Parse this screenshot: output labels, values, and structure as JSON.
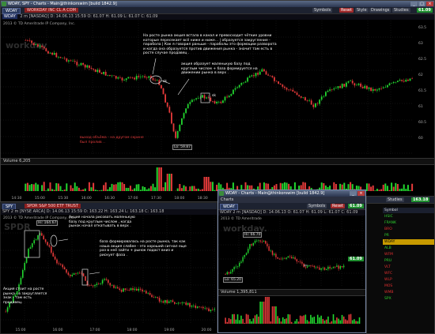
{
  "top_window": {
    "title": "WDAY, SPY - Charts - Main@thinkorswim [build 1842.9]",
    "symbol": "WDAY",
    "desc": "WORKDAY INC CL A COM",
    "buttons": [
      "Symbols",
      "Reset",
      "Style",
      "Drawings",
      "Studies"
    ],
    "price": "61.09",
    "quote": "2 m [NASDAQ]  D: 14.06.13 15:59  O: 61.07  H: 61.09  L: 61.07  C: 61.09",
    "subhead": "2013 © TD Ameritrade IP Company, Inc.",
    "watermark": "workday",
    "annotation_1": "На росте рынка акция встала в канал и превосходит чёткие уровни которые пересекает всё ниже и ниже... | образуется закругление - парабола | Как я говорил раньше - параболы это формации разворота и когда она образуется против движения рынка - значит там есть в росте случае продавец .",
    "annotation_2": "акция образует маленькую базу под круглым числом + база формируется на движении рынка в верх .",
    "annotation_3": "выход объёма - на другом скрине был пролив ..",
    "label_sk": "sk",
    "lo_label": "Lo: 59.87",
    "volume_label": "Volume  6,205",
    "time_ticks": [
      "14:30",
      "15:00",
      "15:30",
      "16:00",
      "16:30",
      "17:00",
      "17:30",
      "18:00",
      "18:30",
      "19:00",
      "19:30",
      "20:00",
      "20:30",
      "21:00",
      "21:30",
      "22:00",
      "22:30",
      "23:00"
    ],
    "price_ticks": [
      "63.5",
      "63",
      "62.5",
      "62",
      "61.5",
      "61",
      "60.5",
      "60"
    ]
  },
  "spy_window": {
    "symbol": "SPY",
    "desc": "SPDR S&P 500 ETF TRUST",
    "quote": "SPY 2 m [NYSE ARCA]  D: 14.06.13 15:59  O: 163.22  H: 163.24  L: 163.18  C: 163.18",
    "subhead": "2013 © TD Ameritrade IP Company, Inc.",
    "watermark": "SPDR",
    "hi_label": "Hi: 164.67",
    "annotation_1": "Акция начала рисовать маленькую базу под круглым числом , когда рынок начал откатывать в верх .",
    "annotation_2": "база формировалась на росте рынка, так как наша акция слабее - это хороший сигнал еще раз в неё зайти + рынок подаст вниз и рискует фаза .",
    "annotation_3": "Акция стоит на росте рынка - в закругляется знак - там есть продавец.",
    "time_ticks": [
      "15:00",
      "16:00",
      "17:00",
      "18:00",
      "19:00",
      "20:00"
    ]
  },
  "mini_window": {
    "title": "WDAY - Charts - Main@thinkorswim [build 1842.9]",
    "charts_label": "Charts",
    "symbol": "WDAY",
    "buttons": [
      "Symbols",
      "Reset",
      "Style",
      "Drawings",
      "Studies"
    ],
    "price": "61.09",
    "quote": "WDAY 2 m [NASDAQ]  D: 14.06.13  O: 61.07  H: 61.09  L: 61.07  C: 61.09",
    "subhead": "2013 © TD Ameritrade",
    "watermark": "workday.",
    "hi_label": "Hi: 66.70",
    "lo_label": "Lo: 65.20",
    "volume_label": "Volume  1,395,811",
    "price_side": "61.09"
  },
  "watchlist": {
    "badge": "163.18",
    "studies": "Studies",
    "header": "Symbol",
    "rows": [
      {
        "sym": "HSIC",
        "color": "#2fd12f"
      },
      {
        "sym": "FRANK",
        "color": "#2fd12f"
      },
      {
        "sym": "BRO",
        "color": "#e03030"
      },
      {
        "sym": "PR",
        "color": "#2fd12f"
      },
      {
        "sym": "WDAY",
        "color": "#ffffff"
      },
      {
        "sym": "ALB",
        "color": "#2fd12f"
      },
      {
        "sym": "WFM",
        "color": "#e03030"
      },
      {
        "sym": "PRU",
        "color": "#2fd12f"
      },
      {
        "sym": "VLT",
        "color": "#e03030"
      },
      {
        "sym": "WFC",
        "color": "#e03030"
      },
      {
        "sym": "WLP",
        "color": "#e03030"
      },
      {
        "sym": "MOS",
        "color": "#e03030"
      },
      {
        "sym": "WMB",
        "color": "#e03030"
      },
      {
        "sym": "SPX",
        "color": "#2fd12f"
      }
    ]
  },
  "colors": {
    "up": "#22d62f",
    "down": "#e53a3a",
    "bg": "#000000",
    "grid": "#2a2a2a"
  }
}
